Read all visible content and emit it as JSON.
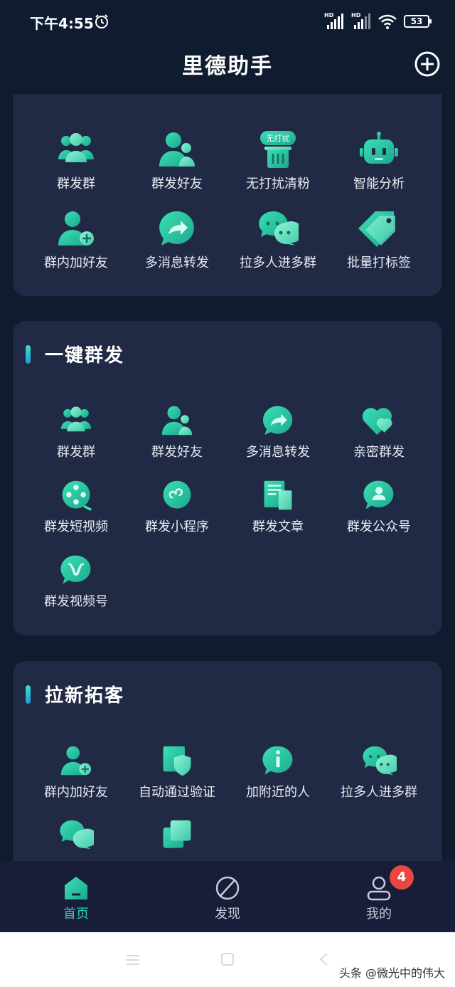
{
  "status_bar": {
    "time": "下午4:55",
    "hd1": "HD",
    "hd2": "HD",
    "battery": "53"
  },
  "header": {
    "title": "里德助手"
  },
  "colors": {
    "accent": "#2fcfae",
    "card": "#212a45",
    "background": "#0f1b2e",
    "badge": "#e8483f"
  },
  "top_tools": [
    {
      "label": "群发群",
      "icon": "group-icon"
    },
    {
      "label": "群发好友",
      "icon": "friends-icon"
    },
    {
      "label": "无打扰清粉",
      "icon": "quiet-clean-icon",
      "tag": "无打扰"
    },
    {
      "label": "智能分析",
      "icon": "robot-icon"
    },
    {
      "label": "群内加好友",
      "icon": "add-friend-icon"
    },
    {
      "label": "多消息转发",
      "icon": "forward-icon"
    },
    {
      "label": "拉多人进多群",
      "icon": "chat-bubbles-icon"
    },
    {
      "label": "批量打标签",
      "icon": "tag-icon"
    }
  ],
  "section_mass_send": {
    "title": "一键群发",
    "items": [
      {
        "label": "群发群",
        "icon": "group-icon"
      },
      {
        "label": "群发好友",
        "icon": "friends-icon"
      },
      {
        "label": "多消息转发",
        "icon": "forward-icon"
      },
      {
        "label": "亲密群发",
        "icon": "heart-icon"
      },
      {
        "label": "群发短视频",
        "icon": "video-reel-icon"
      },
      {
        "label": "群发小程序",
        "icon": "mini-program-icon"
      },
      {
        "label": "群发文章",
        "icon": "article-icon"
      },
      {
        "label": "群发公众号",
        "icon": "official-account-icon"
      },
      {
        "label": "群发视频号",
        "icon": "channels-icon"
      }
    ]
  },
  "section_acquire": {
    "title": "拉新拓客",
    "items": [
      {
        "label": "群内加好友",
        "icon": "add-friend-icon"
      },
      {
        "label": "自动通过验证",
        "icon": "shield-icon"
      },
      {
        "label": "加附近的人",
        "icon": "nearby-icon"
      },
      {
        "label": "拉多人进多群",
        "icon": "chat-bubbles-icon"
      }
    ]
  },
  "bottom_nav": {
    "items": [
      {
        "label": "首页",
        "icon": "home-icon"
      },
      {
        "label": "发现",
        "icon": "discover-icon"
      },
      {
        "label": "我的",
        "icon": "profile-icon"
      }
    ],
    "badge": "4"
  },
  "watermark": "头条 @微光中的伟大"
}
